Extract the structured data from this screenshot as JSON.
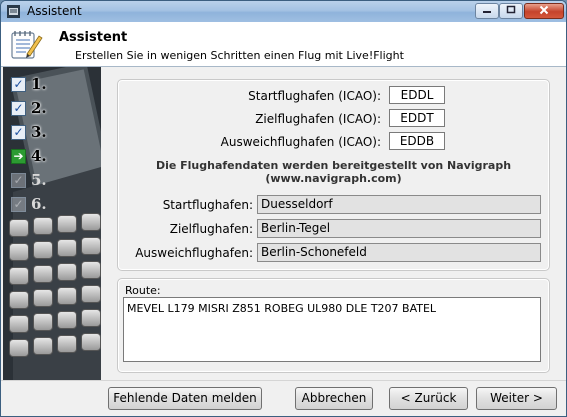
{
  "window": {
    "title": "Assistent"
  },
  "header": {
    "title": "Assistent",
    "subtitle": "Erstellen Sie in wenigen Schritten einen Flug mit Live!Flight"
  },
  "steps": [
    {
      "number": "1.",
      "state": "checked"
    },
    {
      "number": "2.",
      "state": "checked"
    },
    {
      "number": "3.",
      "state": "checked"
    },
    {
      "number": "4.",
      "state": "current"
    },
    {
      "number": "5.",
      "state": "pending"
    },
    {
      "number": "6.",
      "state": "pending"
    }
  ],
  "airports": {
    "departure_label": "Startflughafen (ICAO):",
    "departure_value": "EDDL",
    "destination_label": "Zielflughafen (ICAO):",
    "destination_value": "EDDT",
    "alternate_label": "Ausweichflughafen (ICAO):",
    "alternate_value": "EDDB",
    "navigraph_note_line1": "Die Flughafendaten werden bereitgestellt von Navigraph",
    "navigraph_note_line2": "(www.navigraph.com)"
  },
  "airport_names": {
    "departure_label": "Startflughafen:",
    "departure_value": "Duesseldorf",
    "destination_label": "Zielflughafen:",
    "destination_value": "Berlin-Tegel",
    "alternate_label": "Ausweichflughafen:",
    "alternate_value": "Berlin-Schonefeld"
  },
  "route": {
    "label": "Route:",
    "value": "MEVEL L179 MISRI Z851 ROBEG UL980 DLE T207 BATEL"
  },
  "buttons": {
    "missing_data": "Fehlende Daten melden",
    "cancel": "Abbrechen",
    "back": "< Zurück",
    "next": "Weiter >"
  },
  "colors": {
    "titlebar": "#a4c2e3",
    "close_button": "#c5432c",
    "current_step": "#2c9b32"
  }
}
